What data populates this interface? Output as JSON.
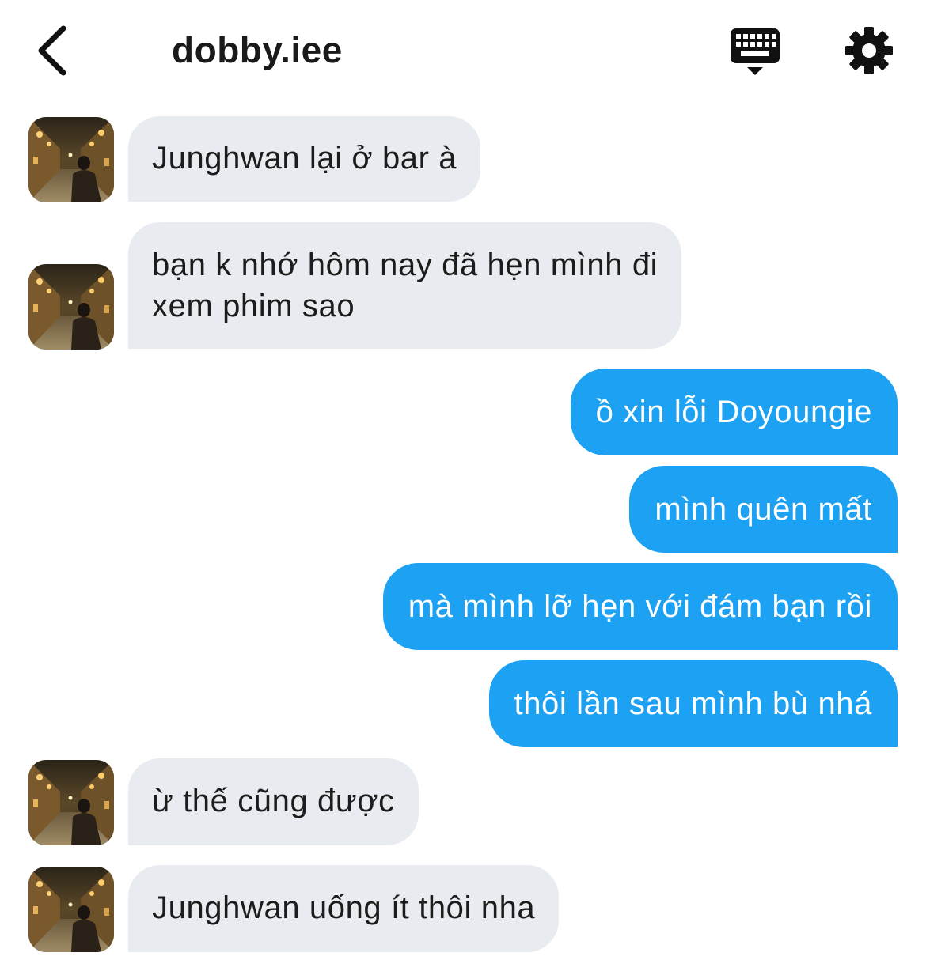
{
  "header": {
    "title": "dobby.iee",
    "back_icon": "chevron-left-icon",
    "keyboard_icon": "keyboard-icon",
    "settings_icon": "gear-icon"
  },
  "colors": {
    "incoming_bubble": "#e8ecf0",
    "outgoing_bubble": "#1da1f2",
    "outgoing_text": "#ffffff",
    "incoming_text": "#1c1c1c"
  },
  "messages": [
    {
      "direction": "in",
      "text": "Junghwan lại ở bar à"
    },
    {
      "direction": "in",
      "lines": [
        "bạn k nhớ hôm nay đã hẹn mình đi",
        "xem phim sao"
      ]
    },
    {
      "direction": "out",
      "text": "ồ xin lỗi Doyoungie"
    },
    {
      "direction": "out",
      "text": "mình quên mất"
    },
    {
      "direction": "out",
      "text": "mà mình lỡ hẹn với đám bạn rồi"
    },
    {
      "direction": "out",
      "text": "thôi lần sau mình bù nhá"
    },
    {
      "direction": "in",
      "text": "ừ thế cũng được"
    },
    {
      "direction": "in",
      "text": "Junghwan uống ít thôi nha"
    }
  ]
}
